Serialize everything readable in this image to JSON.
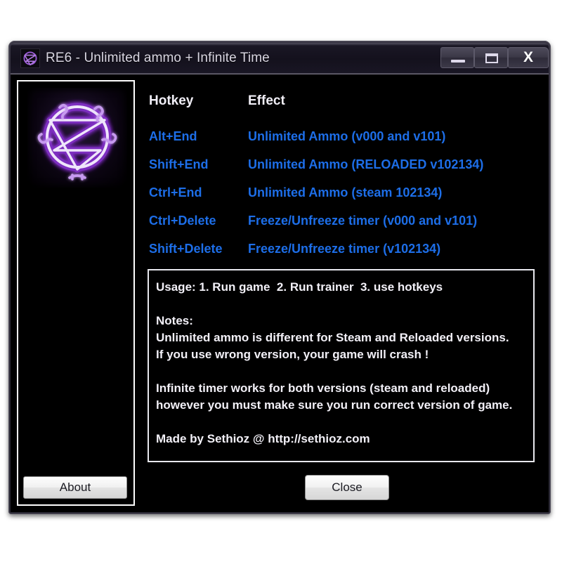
{
  "window": {
    "title": "RE6 - Unlimited ammo + Infinite Time",
    "icon": "pentagram-icon",
    "controls": {
      "minimize_label": "—",
      "maximize_label": "□",
      "close_label": "X"
    }
  },
  "sidebar": {
    "logo_name": "sigil-of-baphomet-logo",
    "about_label": "About"
  },
  "hotkeys": {
    "header_key": "Hotkey",
    "header_effect": "Effect",
    "rows": [
      {
        "key": "Alt+End",
        "effect": "Unlimited Ammo (v000 and v101)"
      },
      {
        "key": "Shift+End",
        "effect": "Unlimited Ammo (RELOADED v102134)"
      },
      {
        "key": "Ctrl+End",
        "effect": "Unlimited Ammo (steam 102134)"
      },
      {
        "key": "Ctrl+Delete",
        "effect": "Freeze/Unfreeze timer (v000 and v101)"
      },
      {
        "key": "Shift+Delete",
        "effect": "Freeze/Unfreeze timer (v102134)"
      }
    ]
  },
  "notes": {
    "lines": [
      "Usage: 1. Run game  2. Run trainer  3. use hotkeys",
      "",
      "Notes:",
      "Unlimited ammo is different for Steam and Reloaded versions.",
      "If you use wrong version, your game will crash !",
      "",
      "Infinite timer works for both versions (steam and reloaded)",
      "however you must make sure you run correct version of game.",
      "",
      "Made by Sethioz @ http://sethioz.com"
    ]
  },
  "footer": {
    "close_label": "Close"
  },
  "colors": {
    "accent_blue": "#1d6ee8",
    "note_text": "#f2f0f7",
    "titlebar": "#14111d",
    "logo_purple": "#8a3ec8",
    "panel_background": "#000000"
  }
}
